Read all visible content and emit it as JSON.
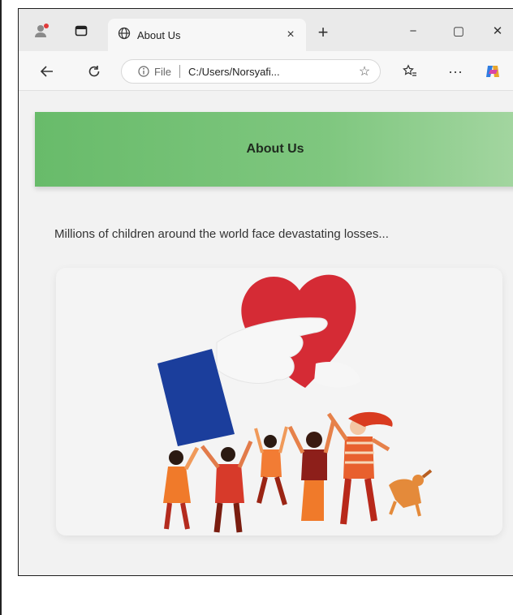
{
  "browser": {
    "tab": {
      "title": "About Us"
    },
    "new_tab_symbol": "+",
    "close_symbol": "×",
    "address": {
      "info_label": "File",
      "url": "C:/Users/Norsyafi..."
    },
    "window_controls": {
      "minimize": "−",
      "maximize": "▢",
      "close": "✕"
    },
    "icons": [
      "profile-icon",
      "tab-actions-icon",
      "globe-icon",
      "back-icon",
      "refresh-icon",
      "info-icon",
      "favorite-star-icon",
      "favorites-icon",
      "more-icon",
      "copilot-icon"
    ]
  },
  "page": {
    "header_title": "About Us",
    "intro_text": "Millions of children around the world face devastating losses...",
    "illustration": "charity-heart-hand-people-illustration"
  },
  "colors": {
    "header_green": "#68bb6a",
    "heart_red": "#d42a34",
    "box_blue": "#1a3e9a",
    "people_orange": "#e7572a"
  }
}
